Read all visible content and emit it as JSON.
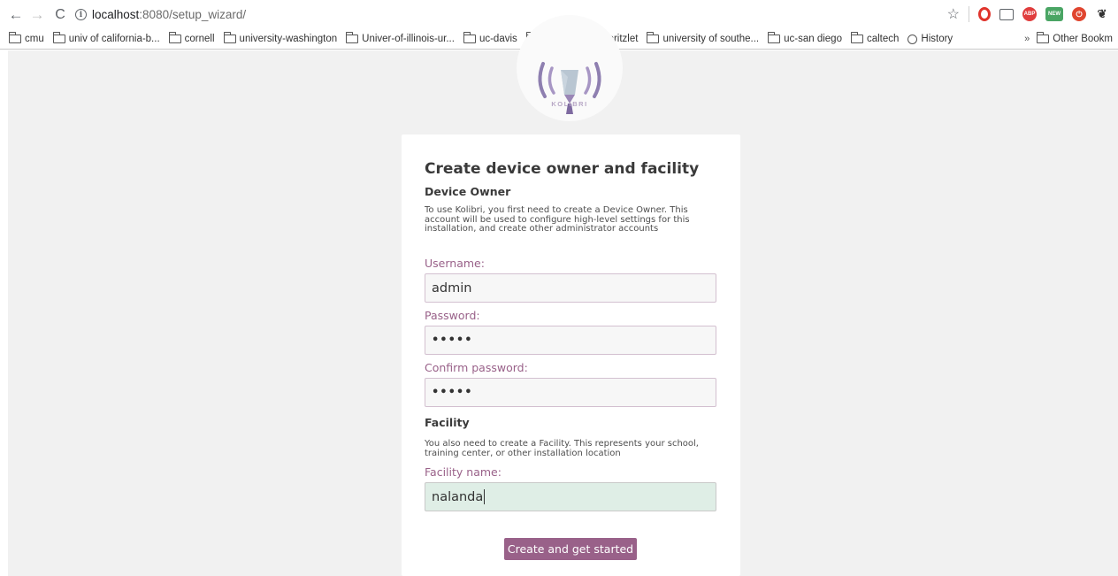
{
  "browser": {
    "url_host": "localhost",
    "url_path": ":8080/setup_wizard/",
    "extensions": [
      {
        "name": "opera-icon"
      },
      {
        "name": "cast-icon"
      },
      {
        "name": "adblock-icon",
        "label": "ABP"
      },
      {
        "name": "new-extension-icon",
        "label": "NEW"
      },
      {
        "name": "power-icon"
      },
      {
        "name": "evernote-icon"
      }
    ]
  },
  "bookmarks": {
    "items": [
      {
        "label": "cmu",
        "icon": "folder"
      },
      {
        "label": "univ of california-b...",
        "icon": "folder"
      },
      {
        "label": "cornell",
        "icon": "folder"
      },
      {
        "label": "university-washington",
        "icon": "folder"
      },
      {
        "label": "Univer-of-illinois-ur...",
        "icon": "folder"
      },
      {
        "label": "uc-davis",
        "icon": "folder"
      },
      {
        "label": "ut-austin",
        "icon": "folder"
      },
      {
        "label": "Spritzlet",
        "icon": "page"
      },
      {
        "label": "university of southe...",
        "icon": "folder"
      },
      {
        "label": "uc-san diego",
        "icon": "folder"
      },
      {
        "label": "caltech",
        "icon": "folder"
      },
      {
        "label": "History",
        "icon": "history"
      }
    ],
    "overflow": "»",
    "other": "Other Bookm"
  },
  "logo": {
    "text": "KOLIBRI"
  },
  "wizard": {
    "title": "Create device owner and facility",
    "owner_section": "Device Owner",
    "owner_desc": "To use Kolibri, you first need to create a Device Owner. This account will be used to configure high-level settings for this installation, and create other administrator accounts",
    "username_label": "Username:",
    "username_value": "admin",
    "password_label": "Password:",
    "password_value": "•••••",
    "confirm_label": "Confirm password:",
    "confirm_value": "•••••",
    "facility_section": "Facility",
    "facility_desc": "You also need to create a Facility. This represents your school, training center, or other installation location",
    "facility_label": "Facility name:",
    "facility_value": "nalanda",
    "submit_label": "Create and get started"
  },
  "colors": {
    "accent": "#996189",
    "focused_field": "#dfeee6",
    "page_background": "#f1f1f1"
  }
}
